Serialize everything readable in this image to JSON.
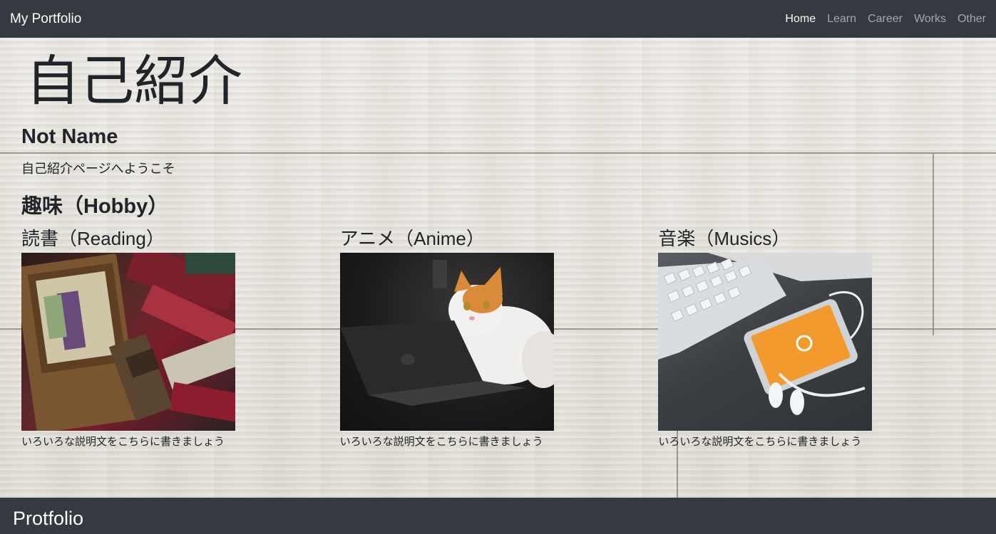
{
  "navbar": {
    "brand": "My Portfolio",
    "links": [
      "Home",
      "Learn",
      "Career",
      "Works",
      "Other"
    ]
  },
  "main": {
    "title": "自己紹介",
    "name": "Not Name",
    "welcome": "自己紹介ページへようこそ",
    "hobby_heading": "趣味（Hobby）",
    "hobbies": [
      {
        "title": "読書（Reading）",
        "caption": "いろいろな説明文をこちらに書きましょう",
        "image": "books-photo"
      },
      {
        "title": "アニメ（Anime）",
        "caption": "いろいろな説明文をこちらに書きましょう",
        "image": "cat-laptop-photo"
      },
      {
        "title": "音楽（Musics）",
        "caption": "いろいろな説明文をこちらに書きましょう",
        "image": "keyboard-phone-photo"
      }
    ]
  },
  "footer": {
    "title": "Protfolio"
  }
}
